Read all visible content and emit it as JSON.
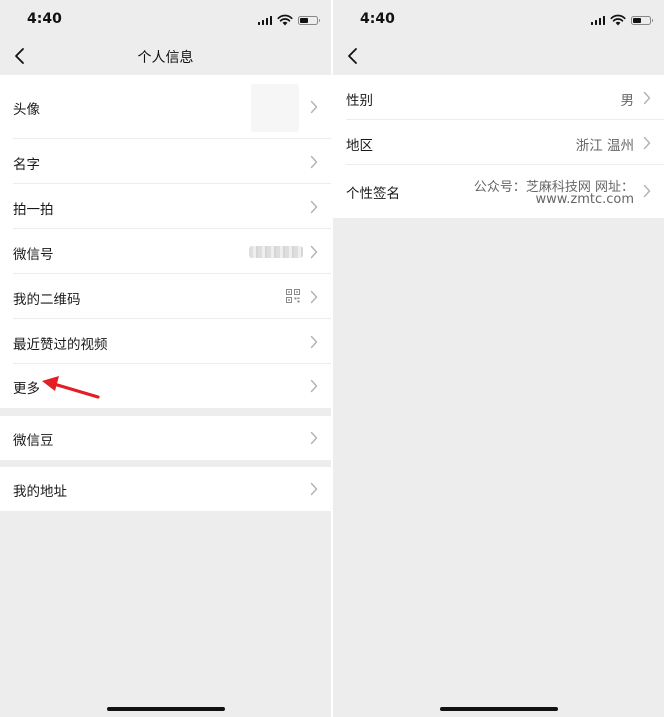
{
  "left_screen": {
    "status": {
      "time": "4:40"
    },
    "nav": {
      "title": "个人信息"
    },
    "rows": [
      {
        "label": "头像"
      },
      {
        "label": "名字"
      },
      {
        "label": "拍一拍"
      },
      {
        "label": "微信号"
      },
      {
        "label": "我的二维码"
      },
      {
        "label": "最近赞过的视频"
      },
      {
        "label": "更多"
      }
    ],
    "group2": {
      "label": "微信豆"
    },
    "group3": {
      "label": "我的地址"
    },
    "annotation": {
      "color": "#e31e24"
    }
  },
  "right_screen": {
    "status": {
      "time": "4:40"
    },
    "rows": [
      {
        "label": "性别",
        "value": "男"
      },
      {
        "label": "地区",
        "value": "浙江 温州"
      },
      {
        "label": "个性签名",
        "value_line1": "公众号：芝麻科技网 网址：",
        "value_line2": "www.zmtc.com"
      }
    ]
  },
  "colors": {
    "background": "#ededed",
    "row": "#ffffff",
    "chevron": "#b2b2b2",
    "arrow": "#e31e24"
  }
}
